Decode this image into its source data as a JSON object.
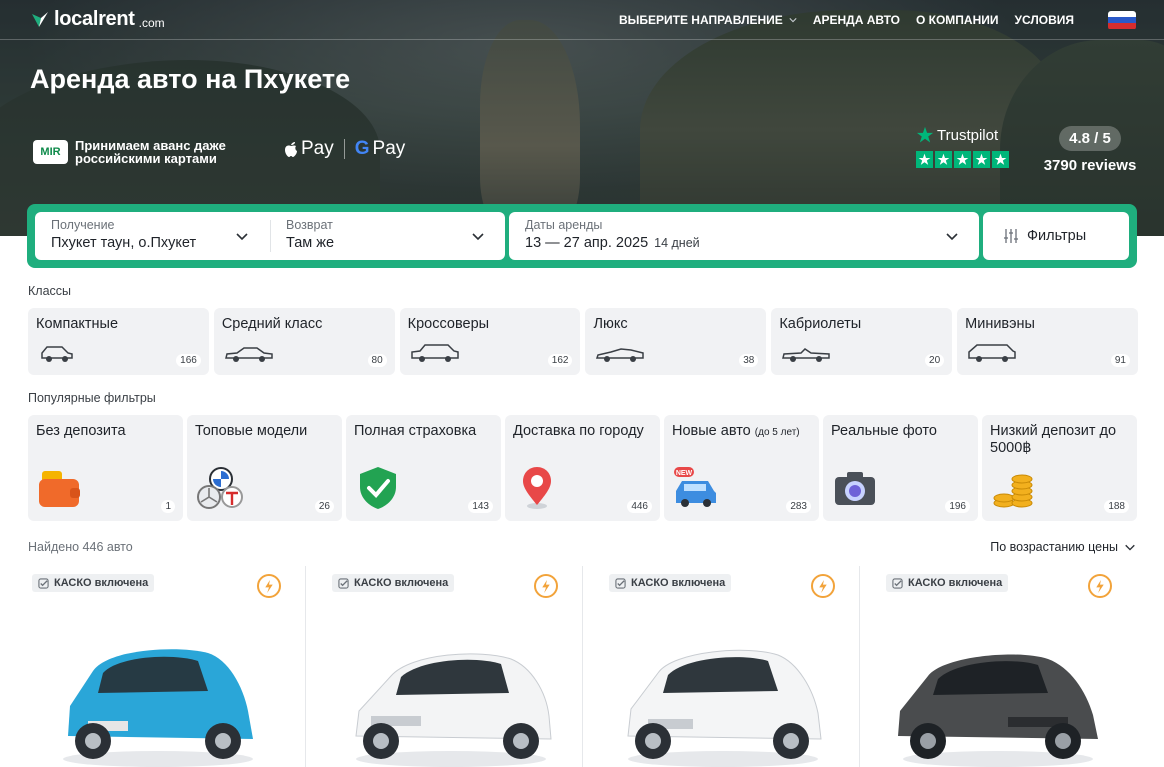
{
  "brand": {
    "name": "localrent",
    "suffix": ".com",
    "accent": "#1fae7e"
  },
  "nav": {
    "items": [
      {
        "label": "ВЫБЕРИТЕ НАПРАВЛЕНИЕ",
        "has_dropdown": true
      },
      {
        "label": "АРЕНДА АВТО",
        "has_dropdown": false
      },
      {
        "label": "О КОМПАНИИ",
        "has_dropdown": false
      },
      {
        "label": "УСЛОВИЯ",
        "has_dropdown": false
      }
    ],
    "language_flag": "flag-ru-icon"
  },
  "hero": {
    "title": "Аренда авто на Пхукете",
    "mir_badge": "MIR",
    "mir_text": "Принимаем аванс даже российскими картами",
    "apple_pay": "Pay",
    "google_pay": "Pay",
    "trustpilot_label": "Trustpilot",
    "rating": "4.8 / 5",
    "reviews": "3790 reviews"
  },
  "search": {
    "pickup_label": "Получение",
    "pickup_value": "Пхукет таун, о.Пхукет",
    "return_label": "Возврат",
    "return_value": "Там же",
    "dates_label": "Даты аренды",
    "dates_value": "13 — 27 апр. 2025",
    "dates_days": "14 дней",
    "filters_label": "Фильтры"
  },
  "classes": {
    "label": "Классы",
    "items": [
      {
        "name": "Компактные",
        "count": "166",
        "icon": "compact-car-icon"
      },
      {
        "name": "Средний класс",
        "count": "80",
        "icon": "sedan-car-icon"
      },
      {
        "name": "Кроссоверы",
        "count": "162",
        "icon": "suv-car-icon"
      },
      {
        "name": "Люкс",
        "count": "38",
        "icon": "sport-car-icon"
      },
      {
        "name": "Кабриолеты",
        "count": "20",
        "icon": "convertible-car-icon"
      },
      {
        "name": "Минивэны",
        "count": "91",
        "icon": "minivan-car-icon"
      }
    ]
  },
  "popular": {
    "label": "Популярные фильтры",
    "items": [
      {
        "name": "Без депозита",
        "small": "",
        "count": "1",
        "icon": "wallet-icon"
      },
      {
        "name": "Топовые модели",
        "small": "",
        "count": "26",
        "icon": "brand-logos-icon"
      },
      {
        "name": "Полная страховка",
        "small": "",
        "count": "143",
        "icon": "shield-check-icon"
      },
      {
        "name": "Доставка по городу",
        "small": "",
        "count": "446",
        "icon": "map-pin-icon"
      },
      {
        "name": "Новые авто",
        "small": "(до 5 лет)",
        "count": "283",
        "icon": "new-car-icon"
      },
      {
        "name": "Реальные фото",
        "small": "",
        "count": "196",
        "icon": "camera-icon"
      },
      {
        "name": "Низкий депозит до 5000฿",
        "small": "",
        "count": "188",
        "icon": "coins-icon"
      }
    ]
  },
  "results": {
    "found": "Найдено 446 авто",
    "sort": "По возрастанию цены",
    "cards": [
      {
        "badge": "КАСКО включена",
        "color": "#2aa6d8"
      },
      {
        "badge": "КАСКО включена",
        "color": "#f2f3f4"
      },
      {
        "badge": "КАСКО включена",
        "color": "#f2f3f4"
      },
      {
        "badge": "КАСКО включена",
        "color": "#4a4c4e"
      }
    ]
  }
}
